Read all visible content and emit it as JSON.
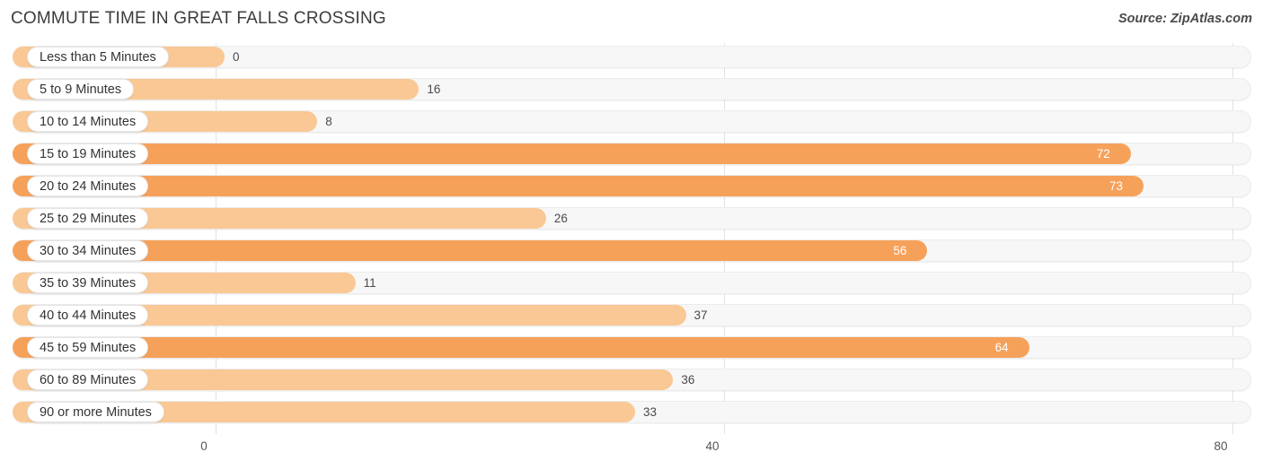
{
  "header": {
    "title": "COMMUTE TIME IN GREAT FALLS CROSSING",
    "source": "Source: ZipAtlas.com"
  },
  "colors": {
    "bar_light": "#fac894",
    "bar_dark": "#f6a15a",
    "track": "#f7f7f7",
    "gridline": "#e2e2e2",
    "label_text": "#333333",
    "value_inside_text": "#ffffff",
    "value_outside_text": "#4a4a4a"
  },
  "chart_data": {
    "type": "bar",
    "orientation": "horizontal",
    "title": "COMMUTE TIME IN GREAT FALLS CROSSING",
    "xlabel": "",
    "ylabel": "",
    "xlim": [
      0,
      80
    ],
    "xticks": [
      0,
      40,
      80
    ],
    "xtick_labels": [
      "0",
      "40",
      "80"
    ],
    "grid": true,
    "legend": false,
    "categories": [
      "Less than 5 Minutes",
      "5 to 9 Minutes",
      "10 to 14 Minutes",
      "15 to 19 Minutes",
      "20 to 24 Minutes",
      "25 to 29 Minutes",
      "30 to 34 Minutes",
      "35 to 39 Minutes",
      "40 to 44 Minutes",
      "45 to 59 Minutes",
      "60 to 89 Minutes",
      "90 or more Minutes"
    ],
    "values": [
      0,
      16,
      8,
      72,
      73,
      26,
      56,
      11,
      37,
      64,
      36,
      33
    ],
    "value_labels": [
      "0",
      "16",
      "8",
      "72",
      "73",
      "26",
      "56",
      "11",
      "37",
      "64",
      "36",
      "33"
    ]
  },
  "rows": [
    {
      "label": "Less than 5 Minutes",
      "value": 0,
      "value_label": "0",
      "shade": "light",
      "label_inside": true
    },
    {
      "label": "5 to 9 Minutes",
      "value": 16,
      "value_label": "16",
      "shade": "light",
      "label_inside": true
    },
    {
      "label": "10 to 14 Minutes",
      "value": 8,
      "value_label": "8",
      "shade": "light",
      "label_inside": true
    },
    {
      "label": "15 to 19 Minutes",
      "value": 72,
      "value_label": "72",
      "shade": "dark",
      "label_inside": false
    },
    {
      "label": "20 to 24 Minutes",
      "value": 73,
      "value_label": "73",
      "shade": "dark",
      "label_inside": false
    },
    {
      "label": "25 to 29 Minutes",
      "value": 26,
      "value_label": "26",
      "shade": "light",
      "label_inside": true
    },
    {
      "label": "30 to 34 Minutes",
      "value": 56,
      "value_label": "56",
      "shade": "dark",
      "label_inside": false
    },
    {
      "label": "35 to 39 Minutes",
      "value": 11,
      "value_label": "11",
      "shade": "light",
      "label_inside": true
    },
    {
      "label": "40 to 44 Minutes",
      "value": 37,
      "value_label": "37",
      "shade": "light",
      "label_inside": true
    },
    {
      "label": "45 to 59 Minutes",
      "value": 64,
      "value_label": "64",
      "shade": "dark",
      "label_inside": false
    },
    {
      "label": "60 to 89 Minutes",
      "value": 36,
      "value_label": "36",
      "shade": "light",
      "label_inside": true
    },
    {
      "label": "90 or more Minutes",
      "value": 33,
      "value_label": "33",
      "shade": "light",
      "label_inside": true
    }
  ],
  "axis": {
    "ticks": [
      "0",
      "40",
      "80"
    ]
  }
}
